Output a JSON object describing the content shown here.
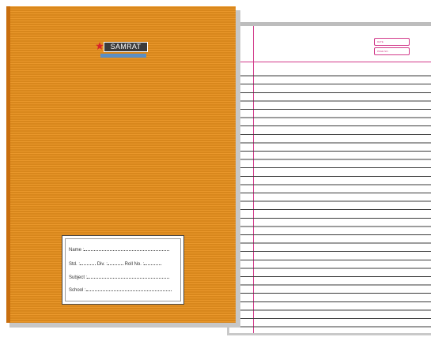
{
  "brand": {
    "name": "SAMRAT"
  },
  "page_header": {
    "date_label": "DATE",
    "page_no_label": "PAGE NO."
  },
  "label_fields": {
    "name": "Name :",
    "std": "Std. :",
    "div": "Div. :",
    "roll_no": "Roll No. :",
    "subject": "Subject :",
    "school": "School :"
  },
  "colors": {
    "cover": "#e8911e",
    "margin_line": "#d23a8a",
    "logo_plate": "#3b3b3b",
    "logo_tagline": "#5b8fc4",
    "logo_mark": "#d8232a"
  }
}
